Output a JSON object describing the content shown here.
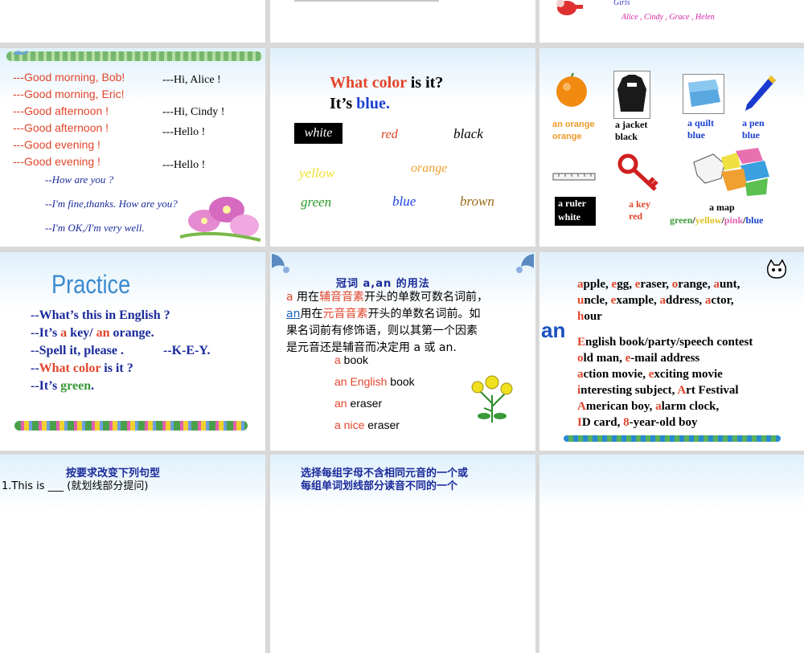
{
  "top_row": {
    "s3_girls_label": "Girls",
    "s3_girls_names": "Alice , Cindy , Grace , Helen"
  },
  "slide_greetings": {
    "left": [
      "---Good morning, Bob!",
      "---Good morning, Eric!",
      "---Good afternoon !",
      "---Good afternoon !",
      "---Good evening  !",
      "---Good evening  !"
    ],
    "right": [
      "---Hi, Alice  !",
      "---Hi, Cindy  !",
      "---Hello !",
      "---Hello  !"
    ],
    "italic": [
      "--How are you ?",
      "--I'm fine,thanks. How are you?",
      "--I'm OK,/I'm very well."
    ]
  },
  "slide_colors": {
    "q_prefix": "What color",
    "q_suffix": " is it?",
    "a_prefix": "It’s ",
    "a_value": "blue.",
    "words": {
      "white": "white",
      "red": "red",
      "black": "black",
      "yellow": "yellow",
      "orange": "orange",
      "green": "green",
      "blue": "blue",
      "brown": "brown"
    }
  },
  "slide_objects": {
    "orange_1": "an orange",
    "orange_2": "orange",
    "jacket_1": "a jacket",
    "jacket_2": "black",
    "quilt_1": "a quilt",
    "quilt_2": "blue",
    "pen_1": "a pen",
    "pen_2": "blue",
    "ruler_1": "a ruler",
    "ruler_2": "white",
    "key_1": "a key",
    "key_2": "red",
    "map_1": "a map",
    "map_green": "green",
    "map_yellow": "yellow",
    "map_pink": "pink",
    "map_blue": "blue"
  },
  "slide_practice": {
    "title": "Practice",
    "l1": "--What’s this in English ?",
    "l2_a": "--It’s ",
    "l2_b": "a",
    "l2_c": " key/ ",
    "l2_d": "an",
    "l2_e": " orange.",
    "l3_a": "--Spell it, please .",
    "l3_b": "--K-E-Y.",
    "l4_a": "--",
    "l4_b": "What color",
    "l4_c": " is it ?",
    "l5_a": "--It’s ",
    "l5_b": "green",
    "l5_c": "."
  },
  "slide_articles": {
    "title": "冠词 a,an 的用法",
    "p1_a": "a",
    "p1_b": " 用在",
    "p1_c": "辅音音素",
    "p1_d": "开头的单数可数名词前，",
    "p2_a": "an",
    "p2_b": "用在",
    "p2_c": "元音音素",
    "p2_d": "开头的单数名词前。如",
    "p3": "果名词前有修饰语，则以其第一个因素",
    "p4": "是元音还是辅音而决定用 a 或 an.",
    "e1_a": "a",
    "e1_b": " book",
    "e2_a": "an English",
    "e2_b": " book",
    "e3_a": "an",
    "e3_b": " eraser",
    "e4_a": "a nice",
    "e4_b": " eraser"
  },
  "slide_an": {
    "an": "an",
    "r1": [
      [
        "a",
        "pple, "
      ],
      [
        "e",
        "gg, "
      ],
      [
        "e",
        "raser, "
      ],
      [
        "o",
        "range, "
      ],
      [
        "a",
        "unt,"
      ]
    ],
    "r2": [
      [
        "u",
        "ncle, "
      ],
      [
        "e",
        "xample, "
      ],
      [
        "a",
        "ddress, "
      ],
      [
        "a",
        "ctor,"
      ]
    ],
    "r3": [
      [
        "h",
        "our"
      ]
    ],
    "r4": [
      [
        "E",
        "nglish book/party/speech contest"
      ]
    ],
    "r5": [
      [
        "o",
        "ld man, "
      ],
      [
        "e",
        "-mail address"
      ]
    ],
    "r6": [
      [
        "a",
        "ction movie, "
      ],
      [
        "e",
        "xciting movie"
      ]
    ],
    "r7": [
      [
        "i",
        "nteresting subject,  "
      ],
      [
        "A",
        "rt Festival"
      ]
    ],
    "r8": [
      [
        "A",
        "merican boy,  "
      ],
      [
        "a",
        "larm clock,"
      ]
    ],
    "r9": [
      [
        "I",
        "D card, "
      ],
      [
        "8",
        "-year-old boy"
      ]
    ]
  },
  "bottom_row": {
    "s7_title": "按要求改变下列句型",
    "s7_line": "1.This is ___ (就划线部分提问)",
    "s8_line1": "选择每组字母不含相同元音的一个或",
    "s8_line2": "每组单词划线部分读音不同的一个"
  }
}
